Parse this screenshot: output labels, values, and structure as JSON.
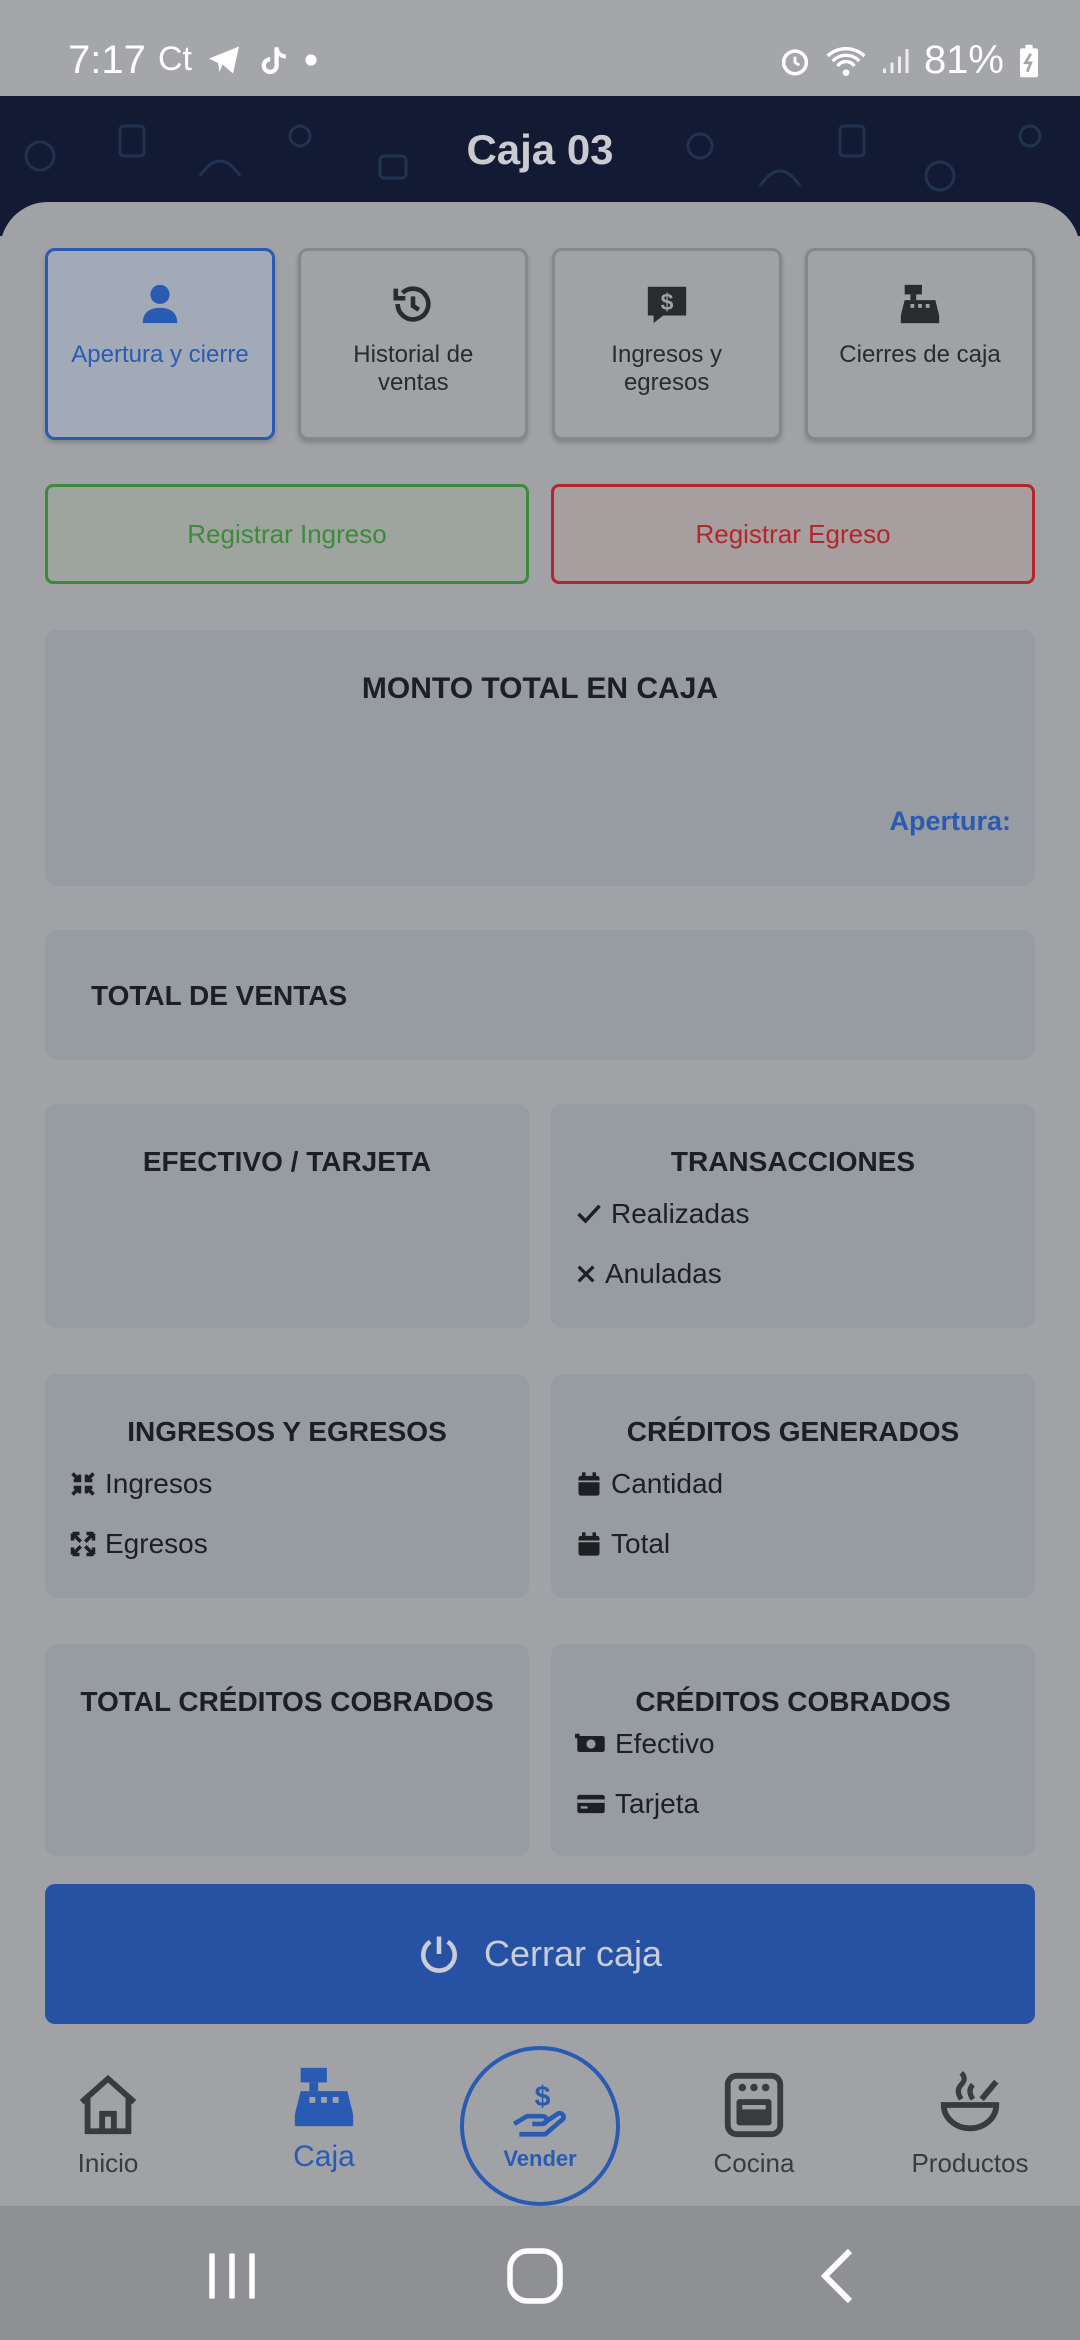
{
  "status_bar": {
    "time": "7:17",
    "battery": "81%",
    "left_icons": [
      "carrier-icon",
      "telegram-icon",
      "tiktok-icon",
      "dot-icon"
    ],
    "right_icons": [
      "alarm-icon",
      "wifi-icon",
      "signal-icon",
      "battery-charging-icon"
    ]
  },
  "header": {
    "title": "Caja 03"
  },
  "tabs": [
    {
      "label": "Apertura y cierre",
      "icon": "user-icon",
      "active": true
    },
    {
      "label": "Historial de ventas",
      "icon": "history-icon",
      "active": false
    },
    {
      "label": "Ingresos y egresos",
      "icon": "message-dollar-icon",
      "active": false
    },
    {
      "label": "Cierres de caja",
      "icon": "cash-register-icon",
      "active": false
    }
  ],
  "actions": {
    "ingreso": "Registrar Ingreso",
    "egreso": "Registrar Egreso"
  },
  "monto": {
    "title": "MONTO TOTAL EN CAJA",
    "apertura_label": "Apertura:"
  },
  "ventas": {
    "title": "TOTAL DE VENTAS"
  },
  "efectivo_tarjeta": {
    "title": "EFECTIVO / TARJETA"
  },
  "transacciones": {
    "title": "TRANSACCIONES",
    "realizadas": "Realizadas",
    "anuladas": "Anuladas"
  },
  "ingresos_egresos": {
    "title": "INGRESOS Y EGRESOS",
    "ingresos": "Ingresos",
    "egresos": "Egresos"
  },
  "creditos_generados": {
    "title": "CRÉDITOS GENERADOS",
    "cantidad": "Cantidad",
    "total": "Total"
  },
  "total_creditos_cobrados": {
    "title": "TOTAL CRÉDITOS COBRADOS"
  },
  "creditos_cobrados": {
    "title": "CRÉDITOS COBRADOS",
    "efectivo": "Efectivo",
    "tarjeta": "Tarjeta"
  },
  "cerrar": {
    "label": "Cerrar caja"
  },
  "bottom_nav": {
    "inicio": "Inicio",
    "caja": "Caja",
    "vender": "Vender",
    "cocina": "Cocina",
    "productos": "Productos"
  },
  "colors": {
    "accent": "#2a5bb3",
    "success": "#3e8a3c",
    "danger": "#b5262b",
    "header_bg": "#131a33"
  }
}
